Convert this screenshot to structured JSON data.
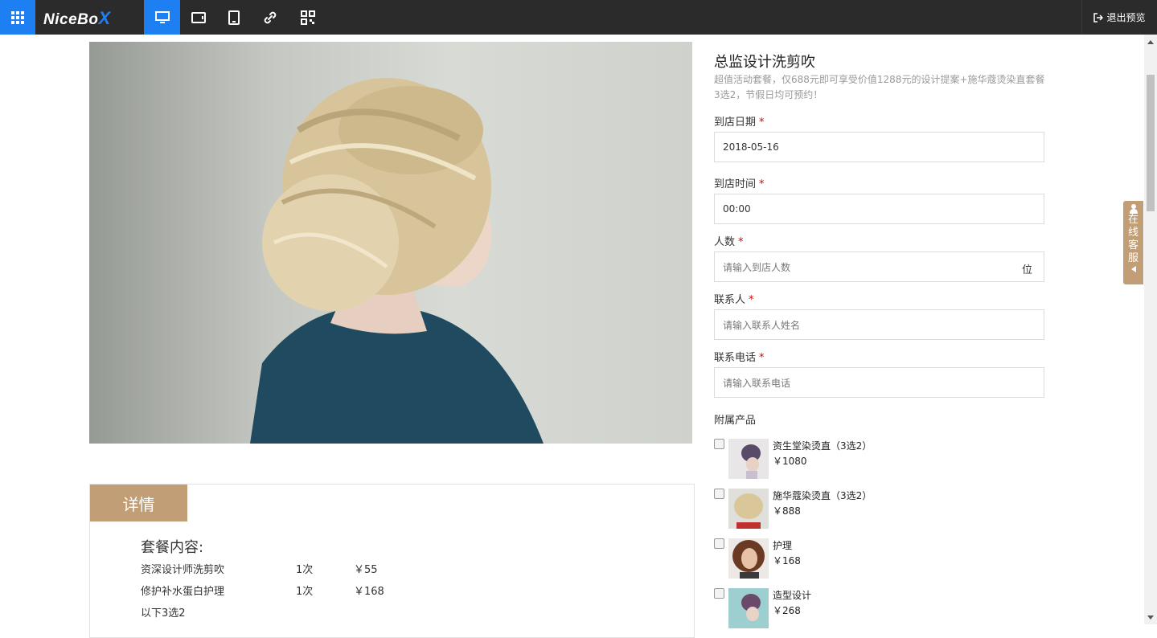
{
  "header": {
    "logo": "NiceBo",
    "logo_x": "X",
    "exit_label": "退出预览"
  },
  "product": {
    "title": "总监设计洗剪吹",
    "description": "超值活动套餐，仅688元即可享受价值1288元的设计提案+施华蔻烫染直套餐3选2，节假日均可预约！"
  },
  "form": {
    "date_label": "到店日期",
    "date_value": "2018-05-16",
    "time_label": "到店时间",
    "time_value": "00:00",
    "people_label": "人数",
    "people_placeholder": "请输入到店人数",
    "people_unit": "位",
    "contact_label": "联系人",
    "contact_placeholder": "请输入联系人姓名",
    "phone_label": "联系电话",
    "phone_placeholder": "请输入联系电话",
    "required_mark": "*",
    "addons_label": "附属产品",
    "addons": [
      {
        "name": "资生堂染烫直（3选2）",
        "price": "￥1080"
      },
      {
        "name": "施华蔻染烫直（3选2）",
        "price": "￥888"
      },
      {
        "name": "护理",
        "price": "￥168"
      },
      {
        "name": "造型设计",
        "price": "￥268"
      }
    ]
  },
  "detail": {
    "tab_label": "详情",
    "heading": "套餐内容:",
    "rows": [
      {
        "item": "资深设计师洗剪吹",
        "qty": "1次",
        "price": "￥55"
      },
      {
        "item": "修护补水蛋白护理",
        "qty": "1次",
        "price": "￥168"
      }
    ],
    "note": "以下3选2"
  },
  "service": {
    "chars": [
      "在",
      "线",
      "客",
      "服"
    ]
  },
  "colors": {
    "accent_blue": "#1e7ff2",
    "brand_tan": "#c29e76",
    "topbar": "#2b2b2b"
  }
}
